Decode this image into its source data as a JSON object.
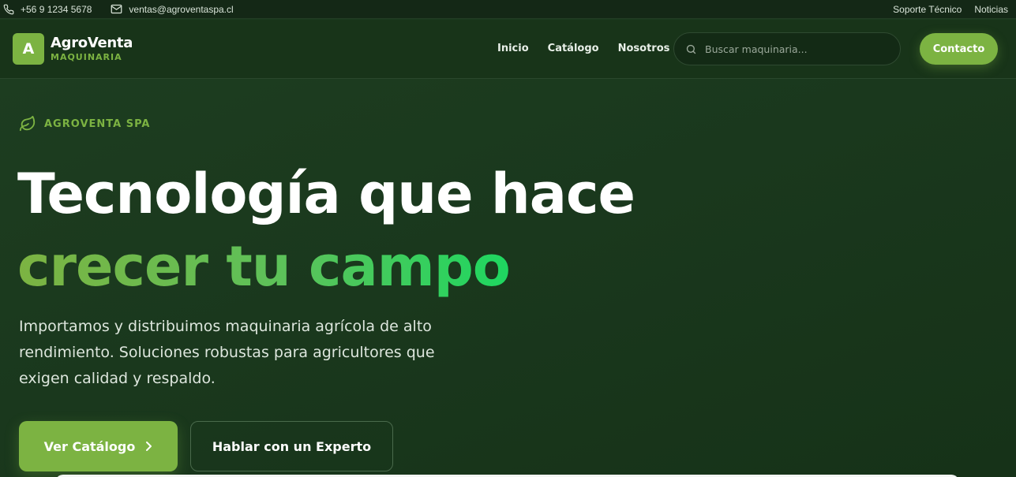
{
  "topbar": {
    "phone": "+56 9 1234 5678",
    "email": "ventas@agroventaspa.cl",
    "links": [
      "Soporte Técnico",
      "Noticias"
    ]
  },
  "brand": {
    "badge": "A",
    "name": "AgroVenta",
    "sub": "MAQUINARIA"
  },
  "nav": {
    "links": [
      "Inicio",
      "Catálogo",
      "Nosotros"
    ],
    "search_placeholder": "Buscar maquinaria...",
    "contact": "Contacto"
  },
  "hero": {
    "eyebrow": "AGROVENTA SPA",
    "headline_line1": "Tecnología que hace",
    "headline_line2": "crecer tu campo",
    "description": "Importamos y distribuimos maquinaria agrícola de alto rendimiento. Soluciones robustas para agricultores que exigen calidad y respaldo.",
    "primary_button": "Ver Catálogo",
    "secondary_button": "Hablar con un Experto"
  },
  "colors": {
    "accent": "#7cb342",
    "background": "#1b3a1e",
    "topbar": "#142816"
  },
  "icons": {
    "phone": "phone-icon",
    "email": "mail-icon",
    "search": "search-icon",
    "leaf": "leaf-icon",
    "arrow": "chevron-right-icon"
  }
}
